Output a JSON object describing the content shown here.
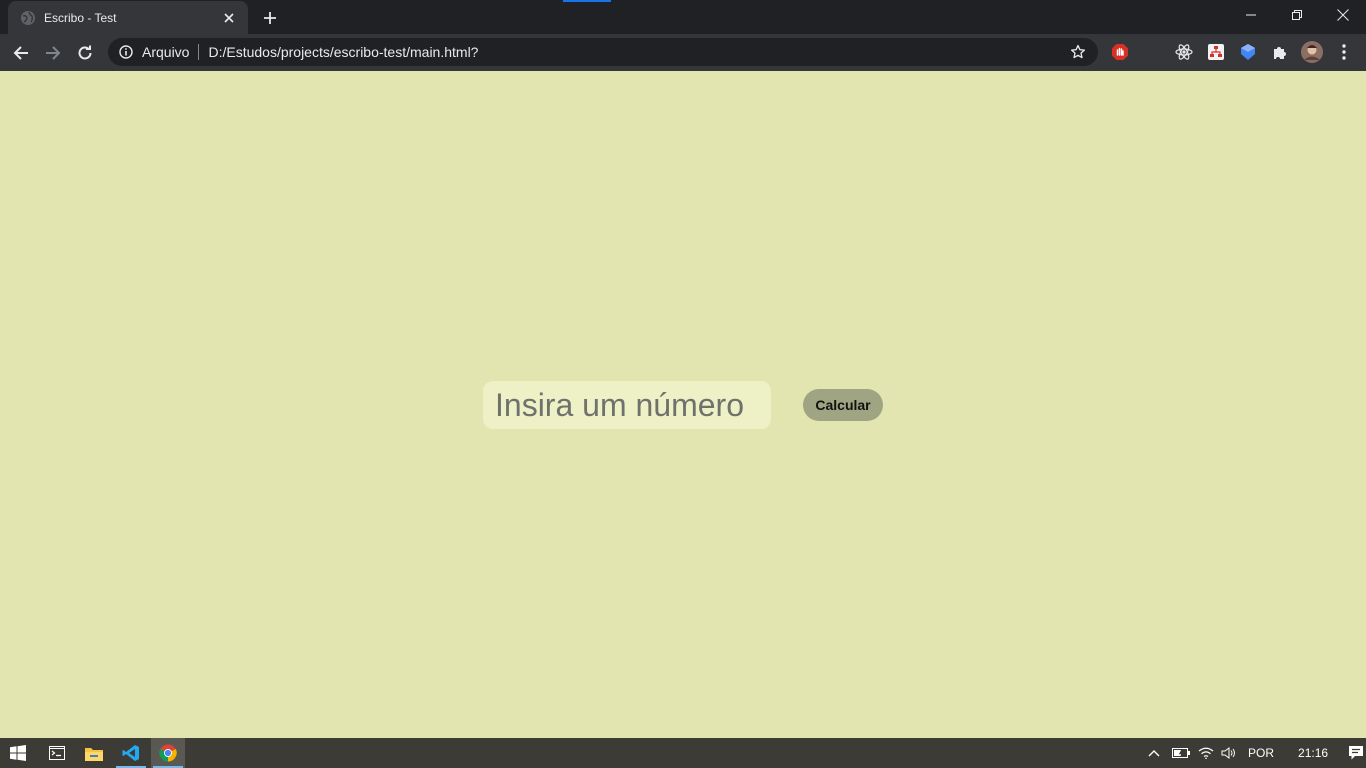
{
  "browser": {
    "tab": {
      "title": "Escribo - Test",
      "favicon": "globe-icon"
    },
    "window_controls": [
      "minimize-icon",
      "restore-icon",
      "close-icon"
    ],
    "omnibox": {
      "security_chip": "Arquivo",
      "url": "D:/Estudos/projects/escribo-test/main.html?"
    },
    "extensions": [
      "adblock-icon",
      "react-devtools-icon",
      "sitemap-extension-icon",
      "ublock-icon",
      "puzzle-extensions-icon",
      "profile-avatar",
      "menu-dots-icon"
    ]
  },
  "page": {
    "background": "#e2e5b0",
    "number_input": {
      "placeholder": "Insira um número",
      "value": ""
    },
    "calculate_button": {
      "label": "Calcular"
    }
  },
  "taskbar": {
    "apps": [
      "windows-start-icon",
      "terminal-icon",
      "file-explorer-icon",
      "vscode-icon",
      "chrome-icon"
    ],
    "tray": {
      "language": "POR",
      "time": "21:16"
    }
  }
}
